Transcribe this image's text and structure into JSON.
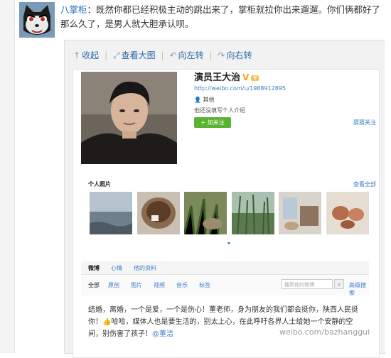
{
  "post": {
    "author": "八掌柜",
    "separator": "：",
    "text": "既然你都已经积极主动的跳出来了，掌柜就拉你出来遛遛。你们俩都好了那么久了，是男人就大胆承认呗。"
  },
  "toolbar": {
    "collapse": "收起",
    "view_large": "查看大图",
    "rotate_left": "向左转",
    "rotate_right": "向右转",
    "divider": "|"
  },
  "profile": {
    "name": "演员王大治",
    "verified_mark": "V",
    "badge": "Y",
    "url": "http://weibo.com/u/1988912895",
    "gender": "其他",
    "bio": "他还没填写个人介绍",
    "follow_button": "+ 加关注",
    "mutual_follow": "猜猜关注"
  },
  "photos": {
    "section_title": "个人照片",
    "view_all": "查看全部",
    "expand": "▾"
  },
  "tabs": [
    "微博",
    "心情",
    "他的资料"
  ],
  "filters": [
    "全部",
    "原创",
    "图片",
    "视频",
    "音乐",
    "标签"
  ],
  "search": {
    "placeholder": "搜索他的微博",
    "advanced": "高级搜索"
  },
  "feed": {
    "line1": "结婚，离婚，一个是爱，一个是伤心！董老师，身为朋友的我们都会挺你，陕西人民挺",
    "line2": "你！",
    "line2_rest": "哈哈，媒体人也是要生活的，别太上心，在此呼吁各界人士给她一个安静的空",
    "line3": "间，别伤害了孩子！",
    "mention": "@董洁"
  },
  "watermark": "weibo.com/bazhanggui",
  "colors": {
    "link": "#1f6fb8",
    "follow_green": "#58b331",
    "panel_bg": "#f2f2f2",
    "verified": "#f0a31c"
  }
}
